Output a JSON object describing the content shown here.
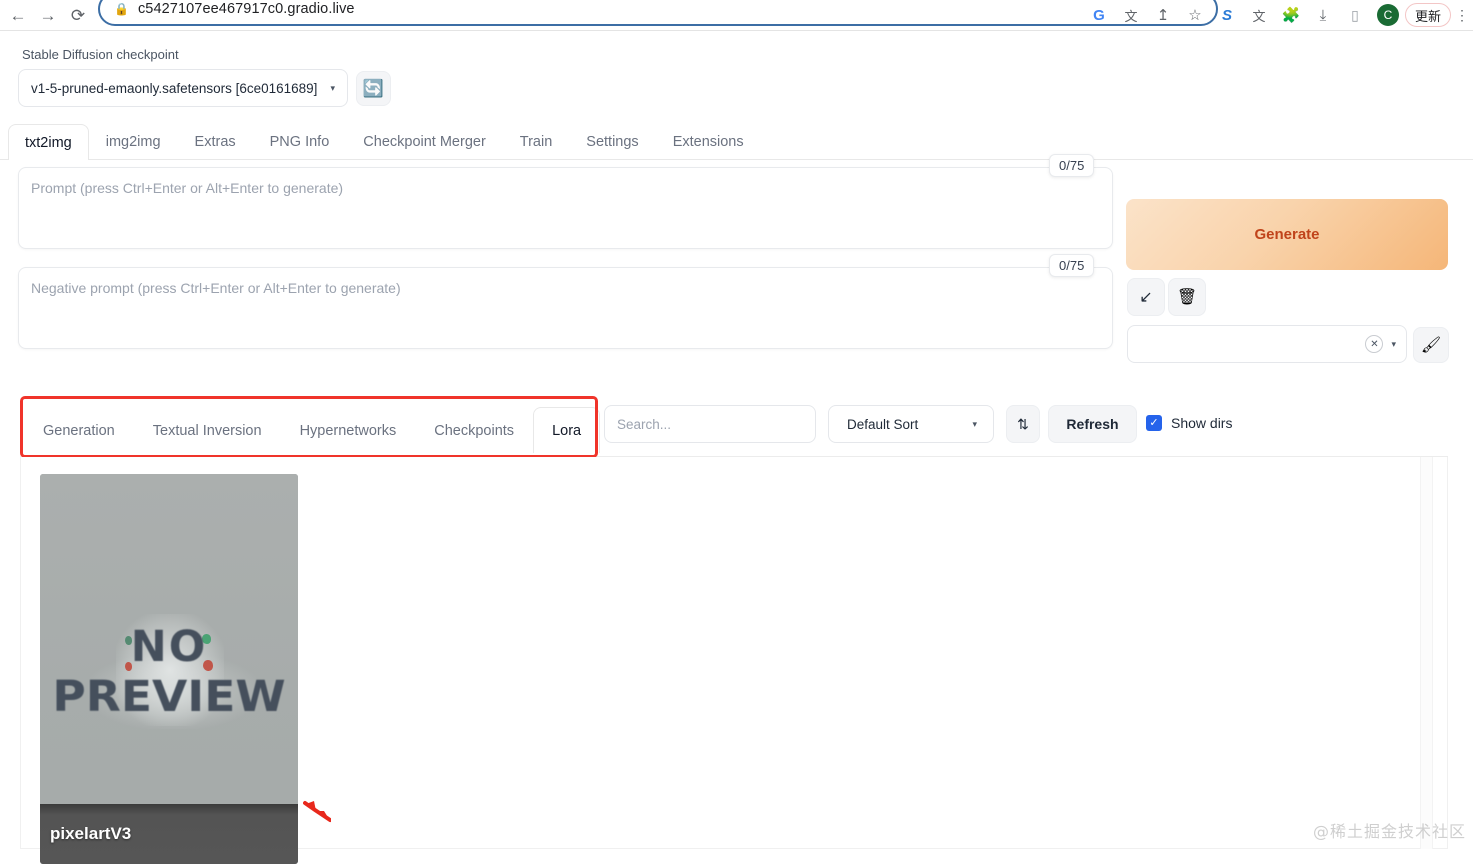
{
  "browser": {
    "back_icon": "←",
    "forward_icon": "→",
    "reload_icon": "⟳",
    "lock_icon": "🔒",
    "url": "c5427107ee467917c0.gradio.live",
    "actions": {
      "google_icon": "G",
      "translate_icon": "文",
      "share_icon": "↥",
      "bookmark_icon": "☆",
      "ext_s_icon": "S",
      "ext_translate_icon": "文",
      "puzzle_icon": "🧩",
      "download_icon": "⤓",
      "sidepanel_icon": "▯",
      "avatar_initial": "C",
      "update_label": "更新",
      "kebab_icon": "⋮"
    }
  },
  "checkpoint": {
    "label": "Stable Diffusion checkpoint",
    "value": "v1-5-pruned-emaonly.safetensors [6ce0161689]",
    "arrow_icon": "▾",
    "refresh_icon": "🔄"
  },
  "main_tabs": [
    {
      "label": "txt2img",
      "active": true
    },
    {
      "label": "img2img",
      "active": false
    },
    {
      "label": "Extras",
      "active": false
    },
    {
      "label": "PNG Info",
      "active": false
    },
    {
      "label": "Checkpoint Merger",
      "active": false
    },
    {
      "label": "Train",
      "active": false
    },
    {
      "label": "Settings",
      "active": false
    },
    {
      "label": "Extensions",
      "active": false
    }
  ],
  "prompt": {
    "placeholder": "Prompt (press Ctrl+Enter or Alt+Enter to generate)",
    "value": "",
    "token_counter": "0/75"
  },
  "negative_prompt": {
    "placeholder": "Negative prompt (press Ctrl+Enter or Alt+Enter to generate)",
    "value": "",
    "token_counter": "0/75"
  },
  "right_panel": {
    "generate_label": "Generate",
    "generate_bg_from": "#fbe3c9",
    "generate_bg_to": "#f5b678",
    "generate_text_color": "#c0441b",
    "read_params_icon": "↙",
    "clear_prompt_icon": "🗑",
    "styles_value": "",
    "styles_clear_icon": "✕",
    "styles_arrow_icon": "▾",
    "edit_styles_icon": "🖌"
  },
  "extra_networks": {
    "highlight_color": "#f0342a",
    "tabs": [
      {
        "label": "Generation",
        "active": false
      },
      {
        "label": "Textual Inversion",
        "active": false
      },
      {
        "label": "Hypernetworks",
        "active": false
      },
      {
        "label": "Checkpoints",
        "active": false
      },
      {
        "label": "Lora",
        "active": true
      }
    ],
    "search_placeholder": "Search...",
    "search_value": "",
    "sort_value": "Default Sort",
    "sort_arrow_icon": "▾",
    "sort_direction_icon": "⇅",
    "refresh_label": "Refresh",
    "show_dirs_label": "Show dirs",
    "show_dirs_checked": true,
    "show_dirs_check_icon": "✓",
    "checkbox_color": "#2563eb"
  },
  "cards": [
    {
      "name": "pixelartV3",
      "preview_line1": "NO",
      "preview_line2": "PREVIEW",
      "preview_bg": "#a9adad"
    }
  ],
  "annotation": {
    "arrow_color": "#e8281c"
  },
  "watermark": "@稀土掘金技术社区"
}
